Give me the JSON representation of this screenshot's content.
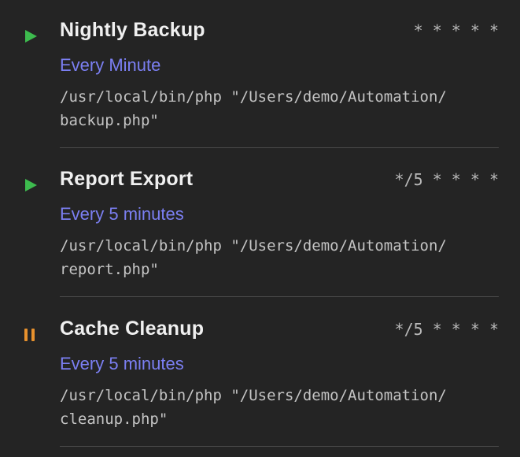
{
  "jobs": [
    {
      "status": "running",
      "status_icon": "play-icon",
      "status_color": "#3dbb4e",
      "title": "Nightly Backup",
      "cron": "* * * * *",
      "schedule": "Every Minute",
      "command_line1": "/usr/local/bin/php \"/Users/demo/Automation/",
      "command_line2": "backup.php\""
    },
    {
      "status": "running",
      "status_icon": "play-icon",
      "status_color": "#3dbb4e",
      "title": "Report Export",
      "cron": "*/5 * * * *",
      "schedule": "Every 5 minutes",
      "command_line1": "/usr/local/bin/php \"/Users/demo/Automation/",
      "command_line2": "report.php\""
    },
    {
      "status": "paused",
      "status_icon": "pause-icon",
      "status_color": "#e8912d",
      "title": "Cache Cleanup",
      "cron": "*/5 * * * *",
      "schedule": "Every 5 minutes",
      "command_line1": "/usr/local/bin/php \"/Users/demo/Automation/",
      "command_line2": "cleanup.php\""
    }
  ],
  "colors": {
    "background": "#242424",
    "title": "#f0f0f0",
    "schedule": "#7b7ff2",
    "command": "#c4c4c4",
    "cron": "#b9b9b9",
    "divider": "#4a4a4a"
  }
}
